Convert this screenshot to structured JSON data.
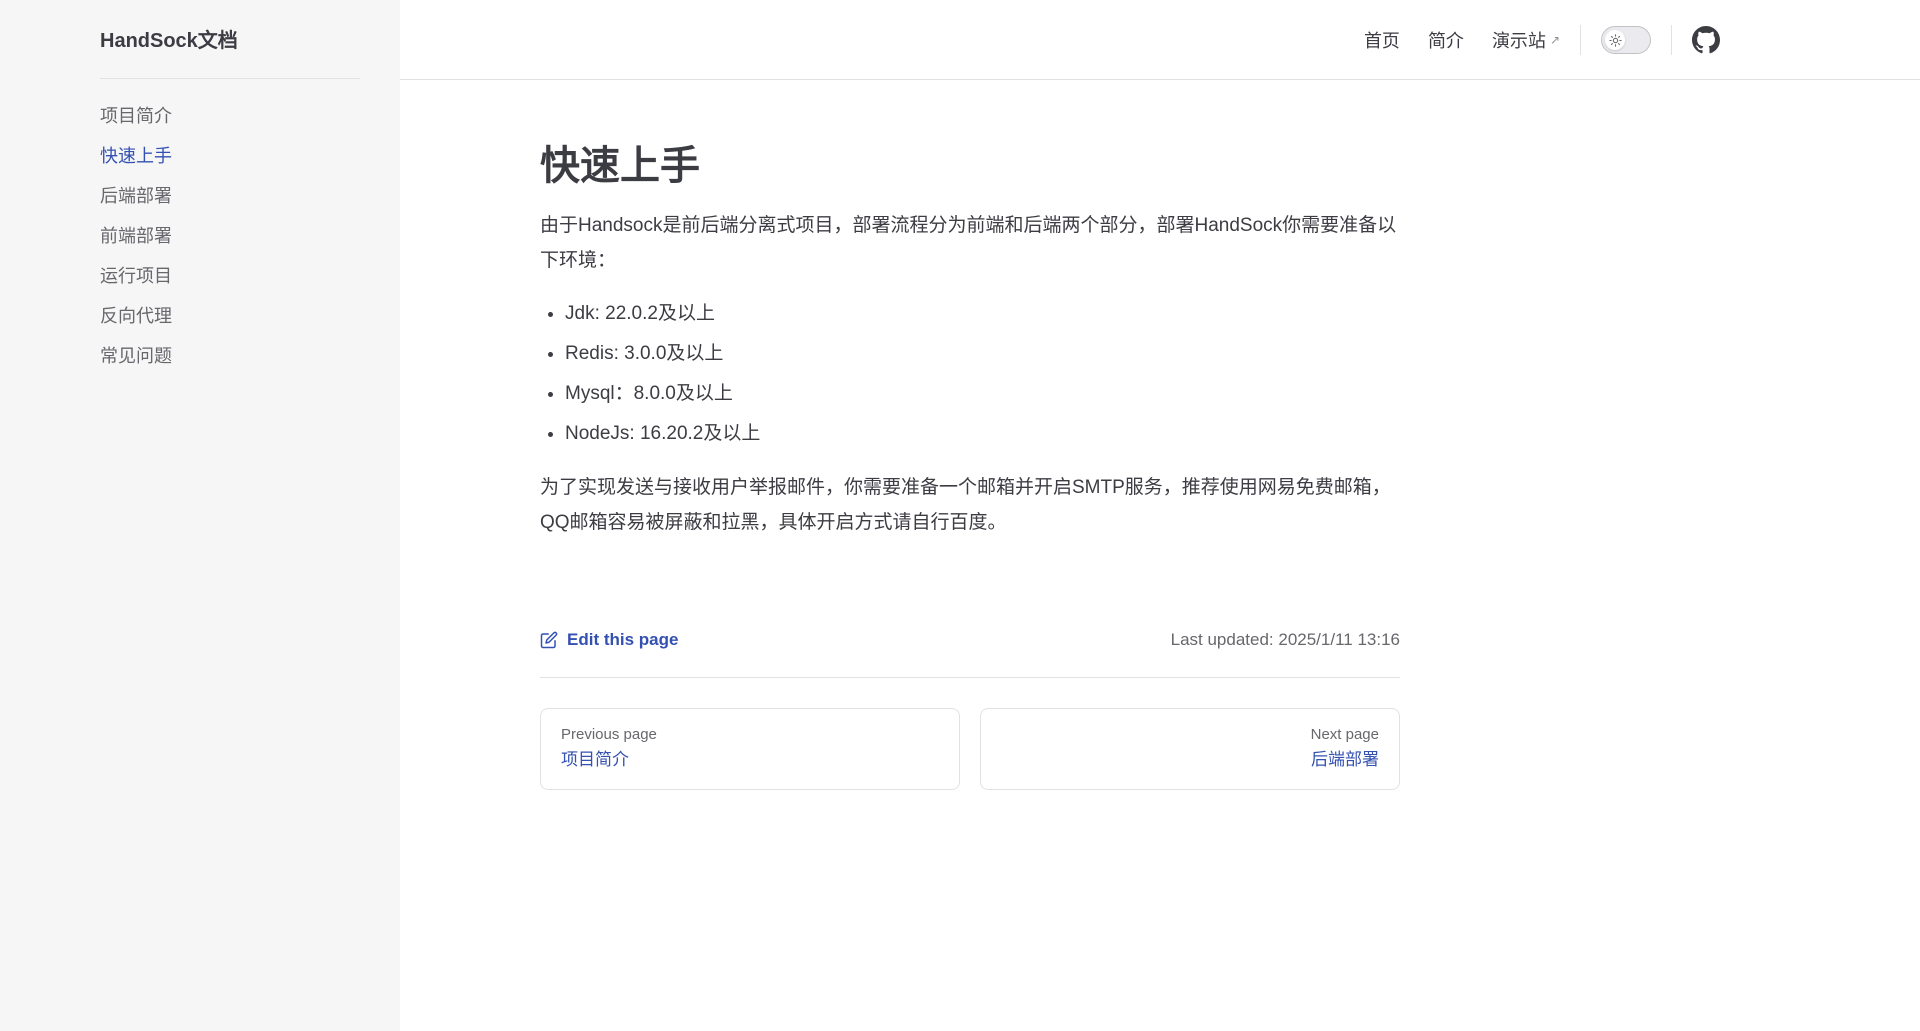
{
  "site": {
    "title": "HandSock文档"
  },
  "sidebar": {
    "items": [
      {
        "label": "项目简介"
      },
      {
        "label": "快速上手"
      },
      {
        "label": "后端部署"
      },
      {
        "label": "前端部署"
      },
      {
        "label": "运行项目"
      },
      {
        "label": "反向代理"
      },
      {
        "label": "常见问题"
      }
    ],
    "active_index": 1
  },
  "nav": {
    "links": [
      {
        "label": "首页"
      },
      {
        "label": "简介"
      },
      {
        "label": "演示站",
        "external": true,
        "arrow": "↗"
      }
    ]
  },
  "icons": {
    "theme_toggle": "sun-icon",
    "repo": "github-icon",
    "edit": "edit-icon"
  },
  "colors": {
    "accent": "#3451b2",
    "sidebar_bg": "#f6f6f7",
    "text": "#3c3c43",
    "muted": "#67676c"
  },
  "content": {
    "title": "快速上手",
    "intro": "由于Handsock是前后端分离式项目，部署流程分为前端和后端两个部分，部署HandSock你需要准备以下环境：",
    "requirements": [
      "Jdk: 22.0.2及以上",
      "Redis: 3.0.0及以上",
      "Mysql：8.0.0及以上",
      "NodeJs: 16.20.2及以上"
    ],
    "note": "为了实现发送与接收用户举报邮件，你需要准备一个邮箱并开启SMTP服务，推荐使用网易免费邮箱，QQ邮箱容易被屏蔽和拉黑，具体开启方式请自行百度。"
  },
  "footer": {
    "edit_label": "Edit this page",
    "last_updated": "Last updated: 2025/1/11 13:16"
  },
  "pager": {
    "prev": {
      "desc": "Previous page",
      "title": "项目简介"
    },
    "next": {
      "desc": "Next page",
      "title": "后端部署"
    }
  }
}
